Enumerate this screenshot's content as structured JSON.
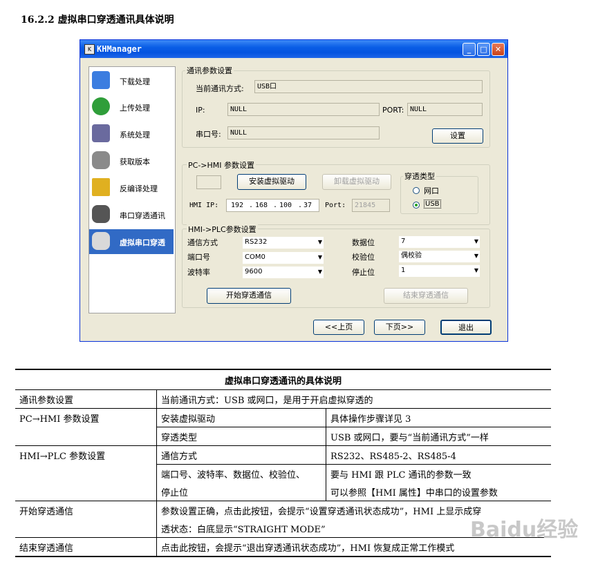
{
  "heading": "16.2.2 虚拟串口穿透通讯具体说明",
  "window": {
    "title": "KHManager",
    "icon_glyph": "K"
  },
  "sidebar": {
    "items": [
      {
        "label": "下载处理",
        "icon": "download-icon",
        "color": "#3b7de0"
      },
      {
        "label": "上传处理",
        "icon": "upload-icon",
        "color": "#2f9e3a"
      },
      {
        "label": "系统处理",
        "icon": "system-icon",
        "color": "#6a6a9e"
      },
      {
        "label": "获取版本",
        "icon": "version-icon",
        "color": "#555555"
      },
      {
        "label": "反编译处理",
        "icon": "decompile-icon",
        "color": "#e0b020"
      },
      {
        "label": "串口穿透通讯",
        "icon": "serial-icon",
        "color": "#444444"
      },
      {
        "label": "虚拟串口穿透",
        "icon": "virtual-serial-icon",
        "color": "#444444"
      }
    ]
  },
  "comm": {
    "group_title": "通讯参数设置",
    "mode_label": "当前通讯方式:",
    "mode_value": "USB口",
    "ip_label": "IP:",
    "ip_value": "NULL",
    "port_label": "PORT:",
    "port_value": "NULL",
    "serial_label": "串口号:",
    "serial_value": "NULL",
    "settings_button": "设置"
  },
  "pc_hmi": {
    "group_title": "PC->HMI 参数设置",
    "install_button": "安装虚拟驱动",
    "uninstall_button": "卸载虚拟驱动",
    "hmi_ip_label": "HMI IP:",
    "ip_octets": [
      "192",
      "168",
      "100",
      "37"
    ],
    "port_label": "Port:",
    "port_value": "21845",
    "type_title": "穿透类型",
    "type_options": [
      "网口",
      "USB"
    ],
    "type_selected": "USB"
  },
  "hmi_plc": {
    "group_title": "HMI->PLC参数设置",
    "comm_mode_label": "通信方式",
    "comm_mode_value": "RS232",
    "port_label": "端口号",
    "port_value": "COM0",
    "baud_label": "波特率",
    "baud_value": "9600",
    "data_bits_label": "数据位",
    "data_bits_value": "7",
    "parity_label": "校验位",
    "parity_value": "偶校验",
    "stop_bits_label": "停止位",
    "stop_bits_value": "1",
    "start_button": "开始穿透通信",
    "end_button": "结束穿透通信"
  },
  "footer": {
    "prev_button": "<<上页",
    "next_button": "下页>>",
    "exit_button": "退出"
  },
  "table": {
    "title": "虚拟串口穿透通讯的具体说明",
    "r1": {
      "c1": "通讯参数设置",
      "c2": "当前通讯方式：USB 或网口，是用于开启虚拟穿透的"
    },
    "r2": {
      "c1": "PC→HMI 参数设置",
      "c2": "安装虚拟驱动",
      "c3": "具体操作步骤详见 3"
    },
    "r3": {
      "c2": "穿透类型",
      "c3": "USB 或网口，要与“当前通讯方式”一样"
    },
    "r4": {
      "c1": "HMI→PLC 参数设置",
      "c2": "通信方式",
      "c3": "RS232、RS485-2、RS485-4"
    },
    "r5": {
      "c2": "端口号、波特率、数据位、校验位、",
      "c3": "要与 HMI 跟 PLC 通讯的参数一致"
    },
    "r6": {
      "c2": "停止位",
      "c3": "可以参照【HMI 属性】中串口的设置参数"
    },
    "r7": {
      "c1": "开始穿透通信",
      "c2": "参数设置正确，点击此按钮，会提示“设置穿透通讯状态成功”，HMI 上显示成穿"
    },
    "r8": {
      "c2": "透状态：白底显示“STRAIGHT MODE”"
    },
    "r9": {
      "c1": "结束穿透通信",
      "c2": "点击此按钮，会提示“退出穿透通讯状态成功”，HMI 恢复成正常工作模式"
    }
  },
  "watermark": "Baidu经验"
}
